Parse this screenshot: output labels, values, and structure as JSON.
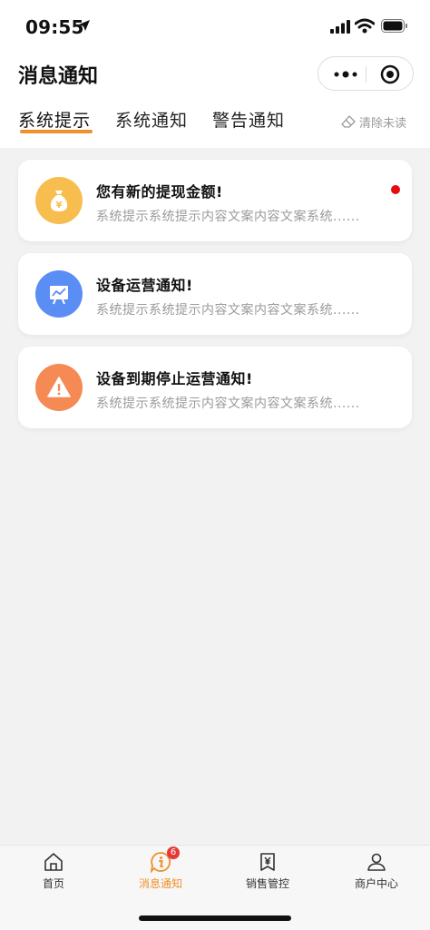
{
  "status_bar": {
    "time": "09:55"
  },
  "header": {
    "title": "消息通知"
  },
  "tabs": [
    {
      "label": "系统提示",
      "active": true
    },
    {
      "label": "系统通知",
      "active": false
    },
    {
      "label": "警告通知",
      "active": false
    }
  ],
  "clear_unread": {
    "label": "清除未读"
  },
  "messages": [
    {
      "title": "您有新的提现金额!",
      "text": "系统提示系统提示内容文案内容文案系统......",
      "icon": "money-bag-icon",
      "icon_color": "#f7bd4e",
      "unread": true
    },
    {
      "title": "设备运营通知!",
      "text": "系统提示系统提示内容文案内容文案系统......",
      "icon": "chart-board-icon",
      "icon_color": "#5a8ef5",
      "unread": false
    },
    {
      "title": "设备到期停止运营通知!",
      "text": "系统提示系统提示内容文案内容文案系统......",
      "icon": "warning-icon",
      "icon_color": "#f58a54",
      "unread": false
    }
  ],
  "tabbar": {
    "items": [
      {
        "label": "首页",
        "icon": "home-icon",
        "active": false
      },
      {
        "label": "消息通知",
        "icon": "message-icon",
        "active": true,
        "badge": "6"
      },
      {
        "label": "销售管控",
        "icon": "sales-icon",
        "active": false
      },
      {
        "label": "商户中心",
        "icon": "user-icon",
        "active": false
      }
    ]
  },
  "colors": {
    "accent": "#f0902a",
    "unread_dot": "#e50b0b",
    "background": "#f2f2f2"
  }
}
